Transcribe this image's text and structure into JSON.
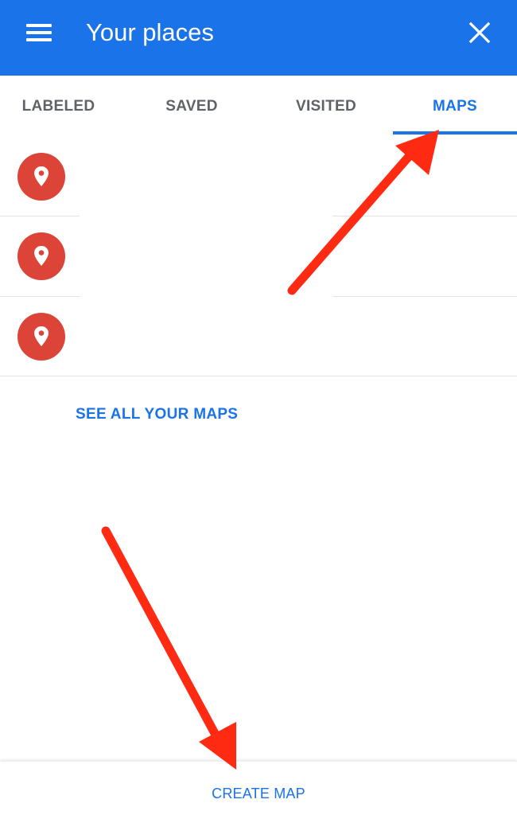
{
  "app_bar": {
    "title": "Your places",
    "menu_icon": "menu-icon",
    "close_icon": "close-icon",
    "background": "#1a73e8"
  },
  "tabs": [
    {
      "label": "LABELED",
      "active": false
    },
    {
      "label": "SAVED",
      "active": false
    },
    {
      "label": "VISITED",
      "active": false
    },
    {
      "label": "MAPS",
      "active": true
    }
  ],
  "maps_list": {
    "items": [
      {
        "icon": "map-pin-icon",
        "name": ""
      },
      {
        "icon": "map-pin-icon",
        "name": ""
      },
      {
        "icon": "map-pin-icon",
        "name": ""
      }
    ],
    "see_all_label": "SEE ALL YOUR MAPS"
  },
  "footer": {
    "create_map_label": "CREATE MAP"
  },
  "colors": {
    "accent": "#1a73e8",
    "pin_circle": "#db4437",
    "annotation_arrow": "#ff2a12"
  }
}
